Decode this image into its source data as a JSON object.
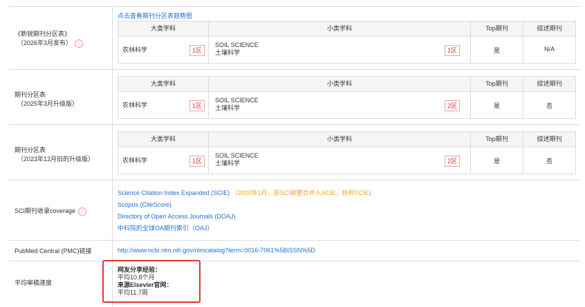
{
  "trend_link": "点击查看期刊分区表趋势图",
  "headers": {
    "major": "大类学科",
    "minor": "小类学科",
    "top": "Top期刊",
    "review": "综述期刊"
  },
  "sections": [
    {
      "label": "《新锐期刊分区表》",
      "note": "（2026年3月发布）",
      "major": "农林科学",
      "major_zone": "1区",
      "minor_en": "SOIL SCIENCE",
      "minor_cn": "土壤科学",
      "minor_zone": "1区",
      "top": "是",
      "review": "N/A"
    },
    {
      "label": "期刊分区表",
      "note": "（2025年3月升级版）",
      "major": "农林科学",
      "major_zone": "1区",
      "minor_en": "SOIL SCIENCE",
      "minor_cn": "土壤科学",
      "minor_zone": "2区",
      "top": "是",
      "review": "否"
    },
    {
      "label": "期刊分区表",
      "note": "（2023年12月旧的升级版）",
      "major": "农林科学",
      "major_zone": "1区",
      "minor_en": "SOIL SCIENCE",
      "minor_cn": "土壤科学",
      "minor_zone": "2区",
      "top": "是",
      "review": "否"
    }
  ],
  "coverage": {
    "label": "SCI期刊收录coverage",
    "scie": "Science Citation Index Expanded (SCIE)",
    "scie_note": "（2020年1月，原SCI被整合并入SCIE，统称SCIE)",
    "scopus": "Scopus (CiteScore)",
    "doaj": "Directory of Open Access Journals (DOAJ)",
    "oaj": "中科院的全球OA期刊索引（OAJ）"
  },
  "pmc": {
    "label": "PubMed Central (PMC)链接",
    "url": "http://www.ncbi.nlm.nih.gov/nlmcatalog?term=0016-7061%5BISSN%5D"
  },
  "review_speed": {
    "label": "平均审稿速度",
    "peer_title": "网友分享经验：",
    "peer_value": "平均10.8个月",
    "official_title": "来源Elsevier官网：",
    "official_value": "平均11.7周"
  },
  "colors": {
    "link": "#1e6fd1",
    "red": "#e8322e",
    "orange": "#f5a623"
  }
}
